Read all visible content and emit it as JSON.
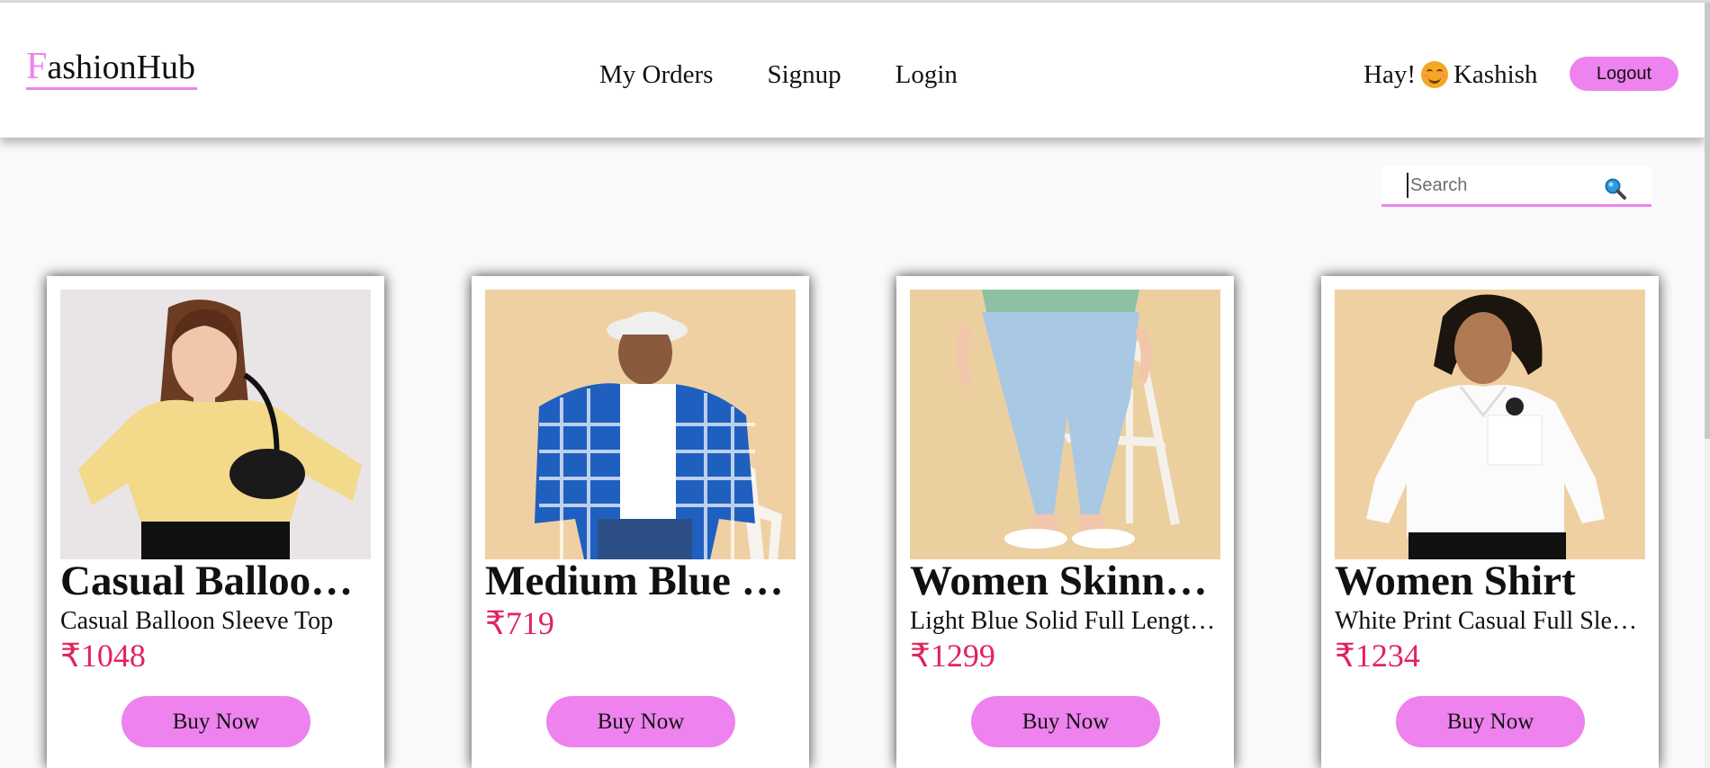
{
  "header": {
    "logo_first": "F",
    "logo_rest": "ashionHub",
    "nav": [
      "My Orders",
      "Signup",
      "Login"
    ],
    "greeting_prefix": "Hay!",
    "user_name": "Kashish",
    "logout_label": "Logout"
  },
  "search": {
    "placeholder": "Search"
  },
  "products": [
    {
      "title": "Casual Balloon Sleeve Top",
      "description": "Casual Balloon Sleeve Top",
      "price": "₹1048",
      "button": "Buy Now"
    },
    {
      "title": "Medium Blue Checked Shirt",
      "description": "",
      "price": "₹719",
      "button": "Buy Now"
    },
    {
      "title": "Women Skinny Jeans",
      "description": "Light Blue Solid Full Length Jeans",
      "price": "₹1299",
      "button": "Buy Now"
    },
    {
      "title": "Women Shirt",
      "description": "White Print Casual Full Sleeve Shirt",
      "price": "₹1234",
      "button": "Buy Now"
    }
  ],
  "colors": {
    "accent": "#ee82ee",
    "price": "#e0245e"
  }
}
